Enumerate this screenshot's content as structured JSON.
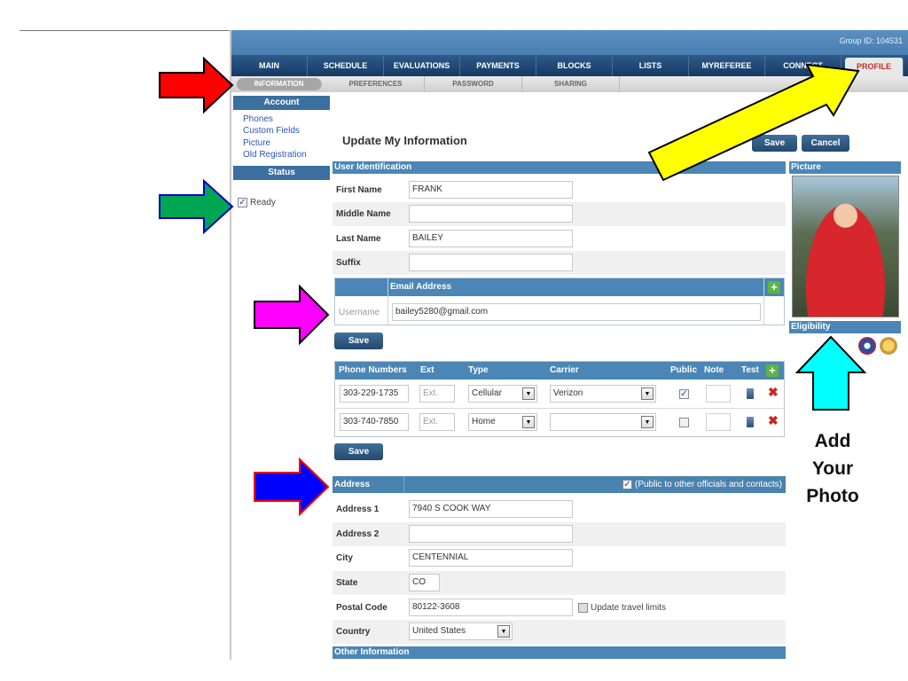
{
  "header": {
    "group_id": "Group ID: 104531"
  },
  "main_nav": [
    "MAIN",
    "SCHEDULE",
    "EVALUATIONS",
    "PAYMENTS",
    "BLOCKS",
    "LISTS",
    "MYREFEREE",
    "CONNECT",
    "PROFILE"
  ],
  "sub_nav": [
    "INFORMATION",
    "PREFERENCES",
    "PASSWORD",
    "SHARING"
  ],
  "sidebar": {
    "account_title": "Account",
    "links": [
      "Phones",
      "Custom Fields",
      "Picture",
      "Old Registration"
    ],
    "status_title": "Status",
    "ready_label": "Ready"
  },
  "page": {
    "title": "Update My Information",
    "save": "Save",
    "cancel": "Cancel"
  },
  "user_identification": {
    "title": "User Identification",
    "first_name_label": "First Name",
    "first_name": "FRANK",
    "middle_name_label": "Middle Name",
    "middle_name": "",
    "last_name_label": "Last Name",
    "last_name": "BAILEY",
    "suffix_label": "Suffix",
    "suffix": ""
  },
  "email": {
    "header": "Email Address",
    "type": "Username",
    "value": "bailey5280@gmail.com",
    "save": "Save"
  },
  "phones": {
    "headers": [
      "Phone Numbers",
      "Ext",
      "Type",
      "Carrier",
      "Public",
      "Note",
      "Test"
    ],
    "rows": [
      {
        "number": "303-229-1735",
        "ext_placeholder": "Ext.",
        "type": "Cellular",
        "carrier": "Verizon",
        "public": true
      },
      {
        "number": "303-740-7850",
        "ext_placeholder": "Ext.",
        "type": "Home",
        "carrier": "",
        "public": false
      }
    ],
    "save": "Save"
  },
  "address": {
    "title": "Address",
    "public_label": "(Public to other officials and contacts)",
    "address1_label": "Address 1",
    "address1": "7940 S COOK WAY",
    "address2_label": "Address 2",
    "address2": "",
    "city_label": "City",
    "city": "CENTENNIAL",
    "state_label": "State",
    "state": "CO",
    "postal_label": "Postal Code",
    "postal": "80122-3608",
    "travel_label": "Update travel limits",
    "country_label": "Country",
    "country": "United States"
  },
  "other_information": {
    "title": "Other Information"
  },
  "right_panel": {
    "picture_title": "Picture",
    "eligibility_title": "Eligibility"
  },
  "annotation": {
    "line1": "Add",
    "line2": "Your",
    "line3": "Photo"
  },
  "colors": {
    "red_arrow": "#ff0000",
    "green_arrow": "#00a651",
    "magenta_arrow": "#ff00ff",
    "blue_arrow": "#0000ff",
    "yellow_arrow": "#ffff00",
    "cyan_arrow": "#00ffff"
  }
}
